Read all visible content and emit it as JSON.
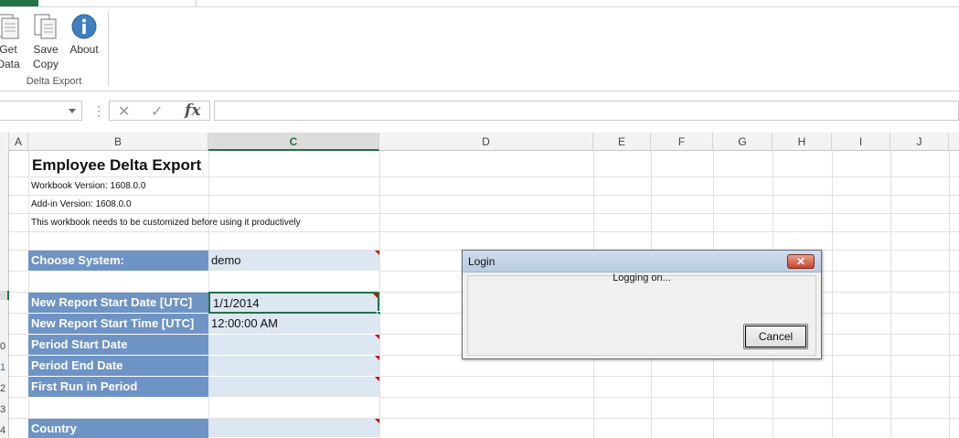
{
  "ribbon": {
    "buttons": [
      {
        "label_line1": "Get",
        "label_line2": "Data",
        "icon": "document-icon"
      },
      {
        "label_line1": "Save",
        "label_line2": "Copy",
        "icon": "save-copy-icon"
      },
      {
        "label_line1": "About",
        "label_line2": "",
        "icon": "info-icon"
      }
    ],
    "group_label": "Delta Export"
  },
  "formula_bar": {
    "fx_label": "fx",
    "cancel_glyph": "✕",
    "enter_glyph": "✓"
  },
  "grid": {
    "columns": [
      "A",
      "B",
      "C",
      "D",
      "E",
      "F",
      "G",
      "H",
      "I",
      "J"
    ],
    "selected_column": "C",
    "row_numbers_visible": [
      "0",
      "1",
      "2",
      "3",
      "4"
    ],
    "title": "Employee Delta Export",
    "workbook_version": "Workbook Version: 1608.0.0",
    "addin_version": "Add-in Version: 1608.0.0",
    "note": "This workbook needs to be customized before using it productively",
    "fields": [
      {
        "label": "Choose System:",
        "value": "demo"
      },
      {
        "label": "New Report Start Date [UTC]",
        "value": "1/1/2014"
      },
      {
        "label": "New Report Start Time [UTC]",
        "value": "12:00:00 AM"
      },
      {
        "label": "Period Start Date",
        "value": ""
      },
      {
        "label": "Period End Date",
        "value": ""
      },
      {
        "label": "First Run in Period",
        "value": ""
      },
      {
        "label": "Country",
        "value": ""
      }
    ]
  },
  "dialog": {
    "title": "Login",
    "close_glyph": "✕",
    "message": "Logging on...",
    "cancel_label": "Cancel"
  },
  "colors": {
    "excel_green": "#217346",
    "label_fill": "#6e93c5",
    "value_fill": "#dde7f1",
    "comment_marker": "#c00000"
  }
}
